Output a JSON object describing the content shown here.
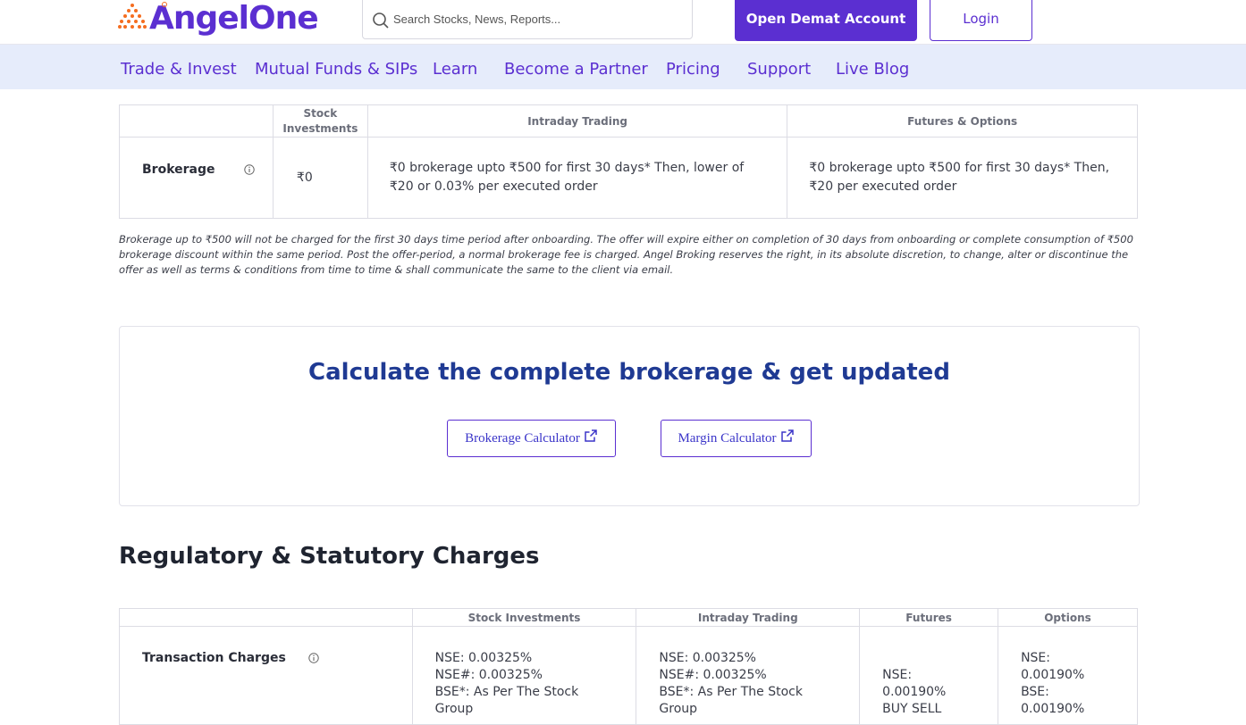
{
  "header": {
    "logo_text": "AngelOne",
    "search_placeholder": "Search Stocks, News, Reports...",
    "open_account_label": "Open Demat Account",
    "login_label": "Login"
  },
  "nav": {
    "items": [
      "Trade & Invest",
      "Mutual Funds & SIPs",
      "Learn",
      "Become a Partner",
      "Pricing",
      "Support",
      "Live Blog"
    ]
  },
  "brokerage_table": {
    "headers": [
      "Stock Investments",
      "Intraday Trading",
      "Futures & Options"
    ],
    "row_label": "Brokerage",
    "cells": [
      "₹0",
      "₹0 brokerage upto ₹500 for first 30 days* Then, lower of ₹20 or 0.03% per executed order",
      "₹0 brokerage upto ₹500 for first 30 days* Then, ₹20 per executed order"
    ]
  },
  "disclaimer": "Brokerage up to ₹500 will not be charged for the first 30 days time period after onboarding. The offer will expire either on completion of 30 days from onboarding or complete consumption of ₹500 brokerage discount within the same period. Post the offer-period, a normal brokerage fee is charged. Angel Broking reserves the right, in its absolute discretion, to change, alter or discontinue the offer as well as terms & conditions from time to time & shall communicate the same to the client via email.",
  "calculator": {
    "title": "Calculate the complete brokerage & get updated",
    "brokerage_btn": "Brokerage Calculator",
    "margin_btn": "Margin Calculator"
  },
  "regulatory": {
    "title": "Regulatory & Statutory Charges",
    "headers": [
      "Stock Investments",
      "Intraday Trading",
      "Futures",
      "Options"
    ],
    "row_label": "Transaction Charges",
    "stock_lines": [
      "NSE: 0.00325%",
      "NSE#: 0.00325%",
      "BSE*: As Per The Stock",
      "Group"
    ],
    "intraday_lines": [
      "NSE: 0.00325%",
      "NSE#: 0.00325%",
      "BSE*: As Per The Stock",
      "Group"
    ],
    "futures_lines": [
      "NSE:",
      "0.00190%",
      "BUY SELL"
    ],
    "options_lines": [
      "NSE:",
      "0.00190%",
      "BSE:",
      "0.00190%"
    ]
  },
  "colors": {
    "brand": "#5b2fd1",
    "nav_bg": "#e6ecfb",
    "logo_accent": "#f56d1f",
    "calc_title": "#1f3a93"
  }
}
